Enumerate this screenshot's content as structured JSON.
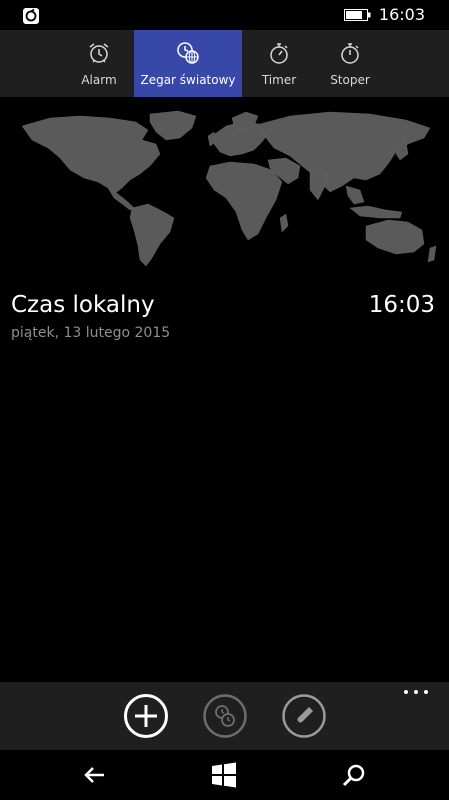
{
  "status_bar": {
    "time": "16:03"
  },
  "tabs": [
    {
      "label": "Alarm",
      "icon": "alarm-clock-icon",
      "active": false
    },
    {
      "label": "Zegar światowy",
      "icon": "world-clock-icon",
      "active": true
    },
    {
      "label": "Timer",
      "icon": "timer-icon",
      "active": false
    },
    {
      "label": "Stoper",
      "icon": "stopwatch-icon",
      "active": false
    }
  ],
  "local_clock": {
    "title": "Czas lokalny",
    "time": "16:03",
    "date": "piątek, 13 lutego 2015"
  },
  "app_bar": {
    "buttons": [
      {
        "icon": "add-icon"
      },
      {
        "icon": "compare-clock-icon"
      },
      {
        "icon": "edit-icon"
      }
    ],
    "more_icon": "more-dots-icon"
  },
  "nav_bar": {
    "buttons": [
      {
        "icon": "back-arrow-icon"
      },
      {
        "icon": "windows-start-icon"
      },
      {
        "icon": "search-icon"
      }
    ]
  },
  "colors": {
    "accent": "#3748a8",
    "bar_background": "#1f1f1f",
    "map_land": "#5a5a5a",
    "secondary_text": "#8e8e8e"
  }
}
